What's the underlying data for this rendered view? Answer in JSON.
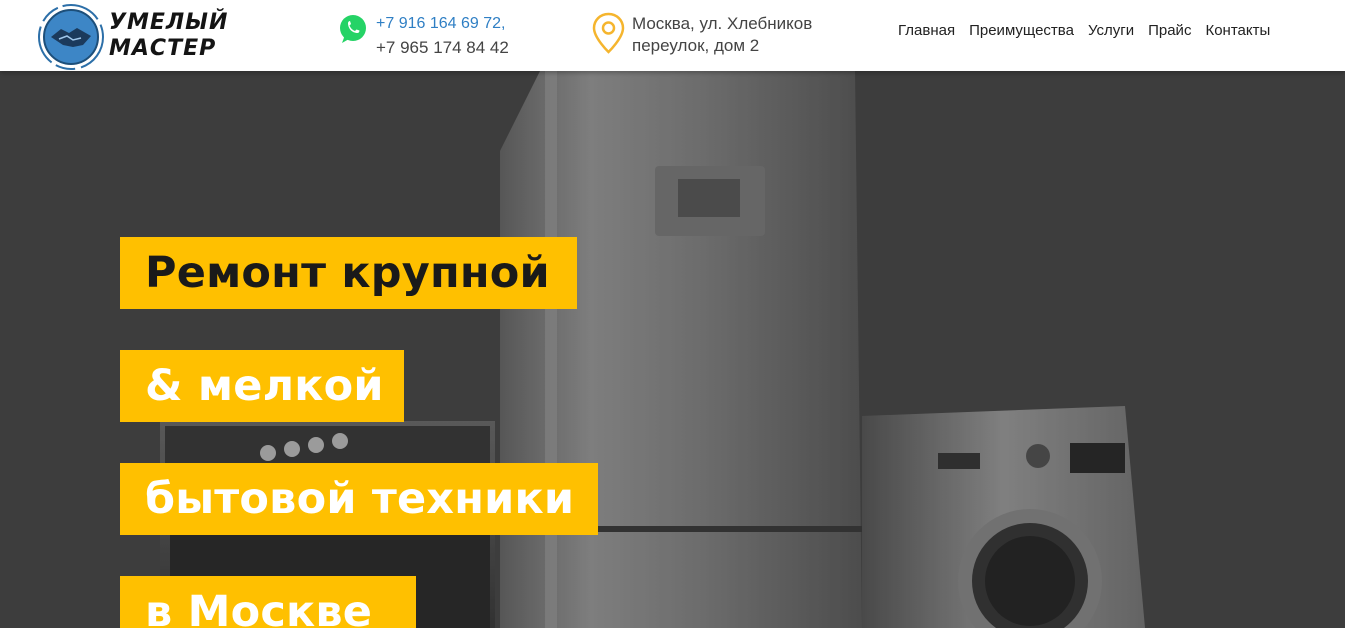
{
  "brand": {
    "line1": "УМЕЛЫЙ",
    "line2": "МАСТЕР",
    "emblem_icon": "handshake-icon"
  },
  "contacts": {
    "phone_icon": "whatsapp-icon",
    "phone1": "+7 916 164 69 72,",
    "phone2": "+7 965 174 84 42",
    "address_icon": "map-pin-icon",
    "address_line1": "Москва, ул. Хлебников",
    "address_line2": "переулок, дом 2"
  },
  "nav": {
    "items": [
      "Главная",
      "Преимущества",
      "Услуги",
      "Прайс",
      "Контакты"
    ]
  },
  "hero": {
    "line1": "Ремонт крупной",
    "line2": "& мелкой",
    "line3": "бытовой техники",
    "line4": "в Москве"
  },
  "colors": {
    "accent": "#ffc000",
    "link": "#2f7fc4",
    "whatsapp": "#25d366",
    "pin": "#f5b52e"
  }
}
